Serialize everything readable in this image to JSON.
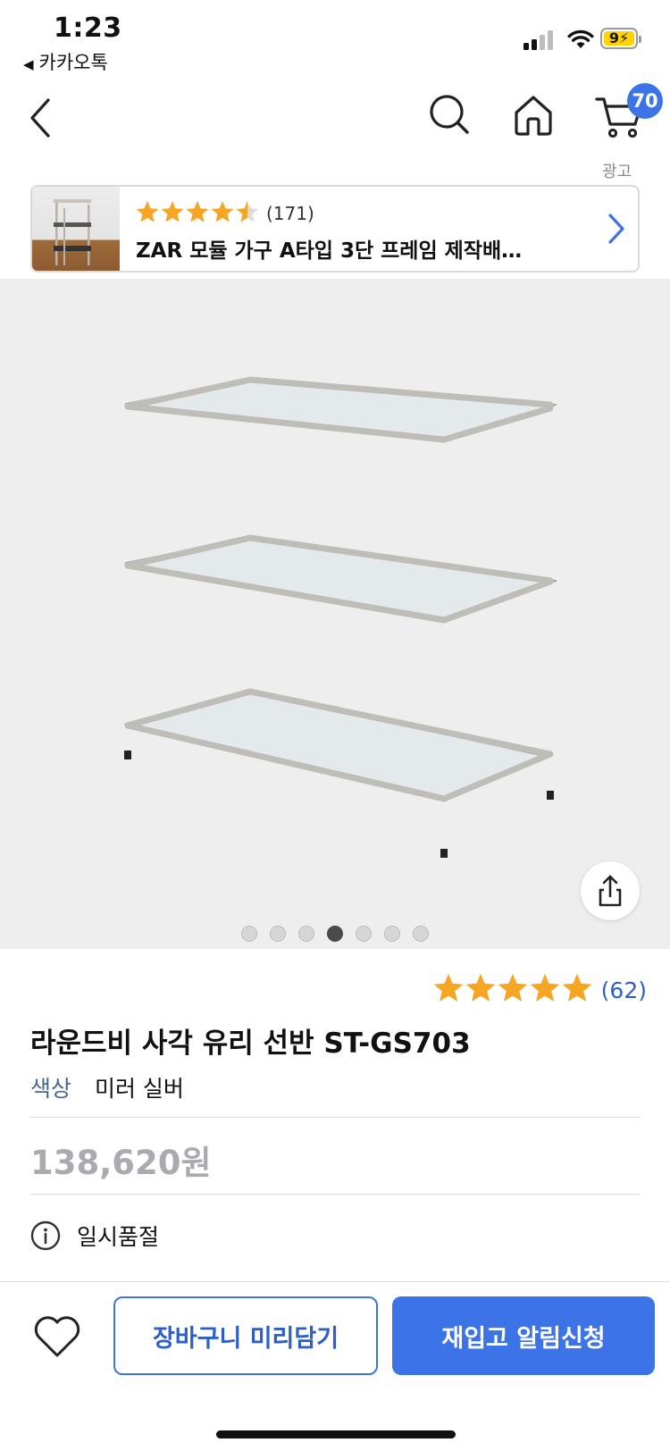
{
  "status_bar": {
    "time": "1:23",
    "back_app": "카카오톡",
    "battery": "9"
  },
  "nav": {
    "back_icon": "chevron-left-icon",
    "search_icon": "search-icon",
    "home_icon": "home-icon",
    "cart_icon": "cart-icon",
    "cart_badge": "70"
  },
  "ad": {
    "label": "광고",
    "rating_value": 4.5,
    "review_count": "(171)",
    "title": "ZAR 모듈 가구 A타입 3단 프레임 제작배…"
  },
  "gallery": {
    "page_count": 7,
    "current_page": 4,
    "share_icon": "share-icon"
  },
  "product": {
    "rating_value": 5,
    "review_count": "(62)",
    "title": "라운드비 사각 유리 선반 ST-GS703",
    "option_label": "색상",
    "option_value": "미러 실버",
    "price": "138,620원",
    "status": "일시품절"
  },
  "bottom_bar": {
    "wishlist_icon": "heart-icon",
    "cart_button": "장바구니 미리담기",
    "restock_button": "재입고 알림신청"
  },
  "colors": {
    "accent": "#3c74e8",
    "star": "#f6a623",
    "price_gray": "#a9abb1"
  }
}
